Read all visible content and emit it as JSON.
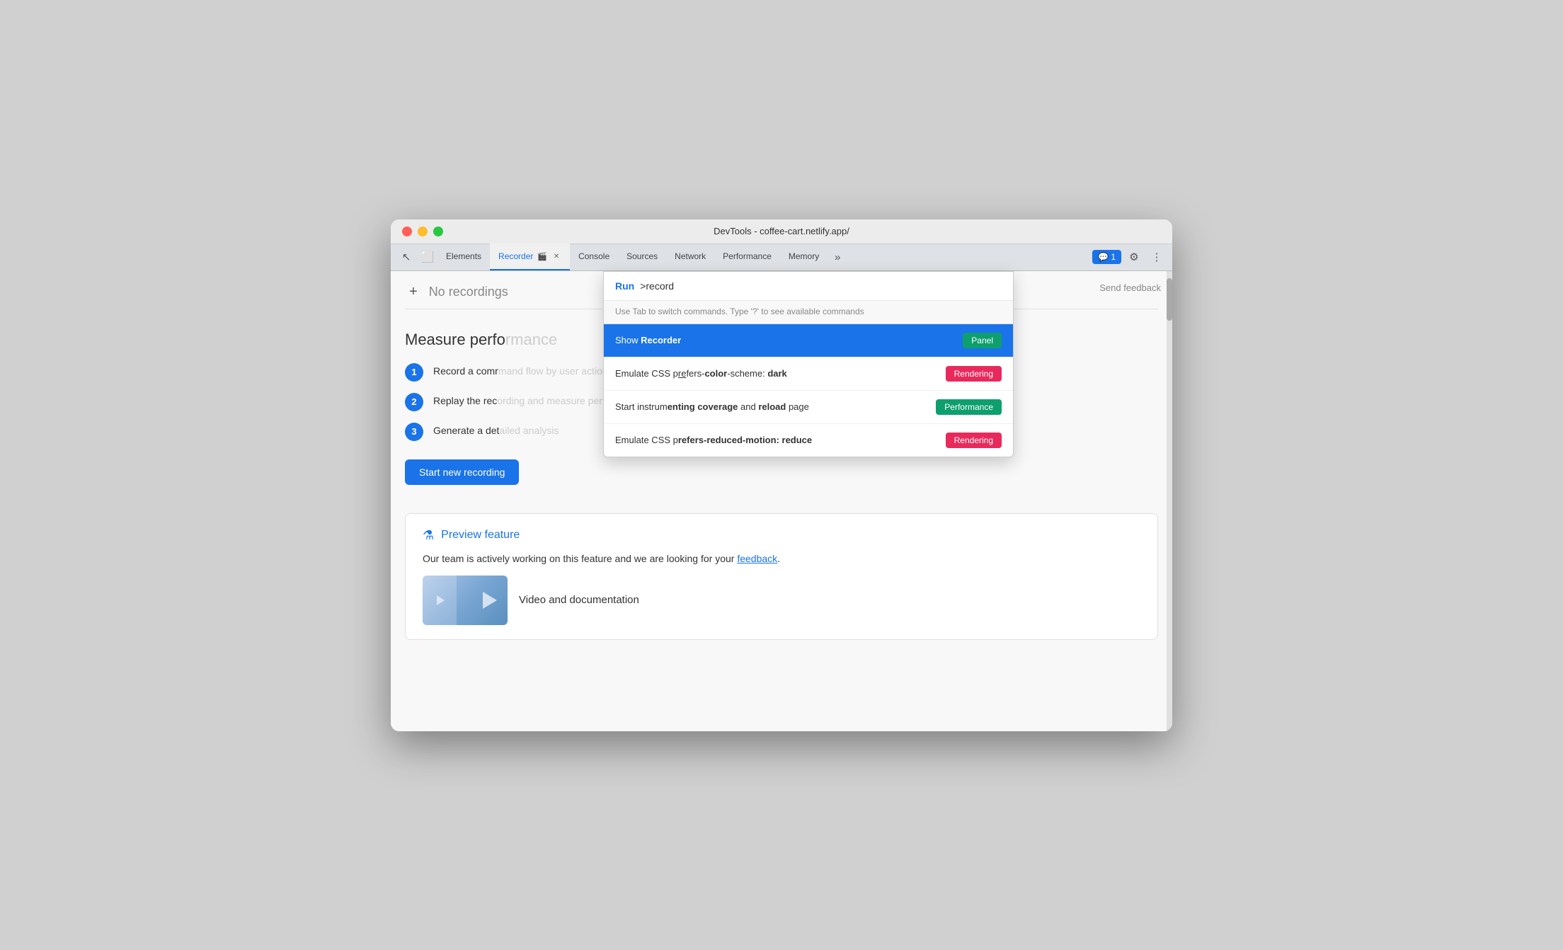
{
  "window": {
    "title": "DevTools - coffee-cart.netlify.app/"
  },
  "titlebar": {
    "traffic_lights": [
      "red",
      "yellow",
      "green"
    ]
  },
  "tabs": [
    {
      "id": "elements",
      "label": "Elements",
      "active": false,
      "closeable": false
    },
    {
      "id": "recorder",
      "label": "Recorder",
      "active": true,
      "closeable": true
    },
    {
      "id": "console",
      "label": "Console",
      "active": false,
      "closeable": false
    },
    {
      "id": "sources",
      "label": "Sources",
      "active": false,
      "closeable": false
    },
    {
      "id": "network",
      "label": "Network",
      "active": false,
      "closeable": false
    },
    {
      "id": "performance",
      "label": "Performance",
      "active": false,
      "closeable": false
    },
    {
      "id": "memory",
      "label": "Memory",
      "active": false,
      "closeable": false
    }
  ],
  "toolbar": {
    "more_tabs_label": "»",
    "feedback_badge": "💬 1",
    "settings_icon": "⚙",
    "more_icon": "⋮"
  },
  "recorder_panel": {
    "add_button_label": "+",
    "no_recordings_text": "No recordings",
    "send_feedback_label": "Send feedback",
    "measure_perf_title": "Measure perfo",
    "steps": [
      {
        "num": "1",
        "text": "Record a comr"
      },
      {
        "num": "2",
        "text": "Replay the rec"
      },
      {
        "num": "3",
        "text": "Generate a det"
      }
    ],
    "start_recording_btn": "Start new recording"
  },
  "preview_feature": {
    "title": "Preview feature",
    "description": "Our team is actively working on this feature and we are looking for your ",
    "link_text": "feedback",
    "description_end": ".",
    "video_docs_label": "Video and documentation"
  },
  "command_palette": {
    "run_label": "Run",
    "input_value": ">record",
    "hint_text": "Use Tab to switch commands. Type '?' to see available commands",
    "items": [
      {
        "id": "show-recorder",
        "text_parts": [
          {
            "text": "Show ",
            "bold": false
          },
          {
            "text": "Recorder",
            "bold": true
          }
        ],
        "full_text": "Show Recorder",
        "badge_label": "Panel",
        "badge_class": "badge-panel",
        "highlighted": true
      },
      {
        "id": "emulate-css-dark",
        "text_parts": [
          {
            "text": "Emulate CSS p",
            "bold": false
          },
          {
            "text": "re",
            "bold": false
          },
          {
            "text": "fers-",
            "bold": false
          },
          {
            "text": "color",
            "bold": true
          },
          {
            "text": "-scheme: ",
            "bold": false
          },
          {
            "text": "dark",
            "bold": true
          }
        ],
        "full_text": "Emulate CSS prefers-color-scheme: dark",
        "badge_label": "Rendering",
        "badge_class": "badge-rendering",
        "highlighted": false
      },
      {
        "id": "start-coverage",
        "text_parts": [
          {
            "text": "Start instrum",
            "bold": false
          },
          {
            "text": "enting ",
            "bold": false
          },
          {
            "text": "coverage",
            "bold": true
          },
          {
            "text": " and ",
            "bold": false
          },
          {
            "text": "reload",
            "bold": true
          },
          {
            "text": " page",
            "bold": false
          }
        ],
        "full_text": "Start instrumenting coverage and reload page",
        "badge_label": "Performance",
        "badge_class": "badge-performance",
        "highlighted": false
      },
      {
        "id": "emulate-css-reduce",
        "text_parts": [
          {
            "text": "Emulate CSS p",
            "bold": false
          },
          {
            "text": "refers-reduced-motion: ",
            "bold": false
          },
          {
            "text": "reduce",
            "bold": true
          }
        ],
        "full_text": "Emulate CSS prefers-reduced-motion: reduce",
        "badge_label": "Rendering",
        "badge_class": "badge-rendering",
        "highlighted": false
      }
    ]
  }
}
